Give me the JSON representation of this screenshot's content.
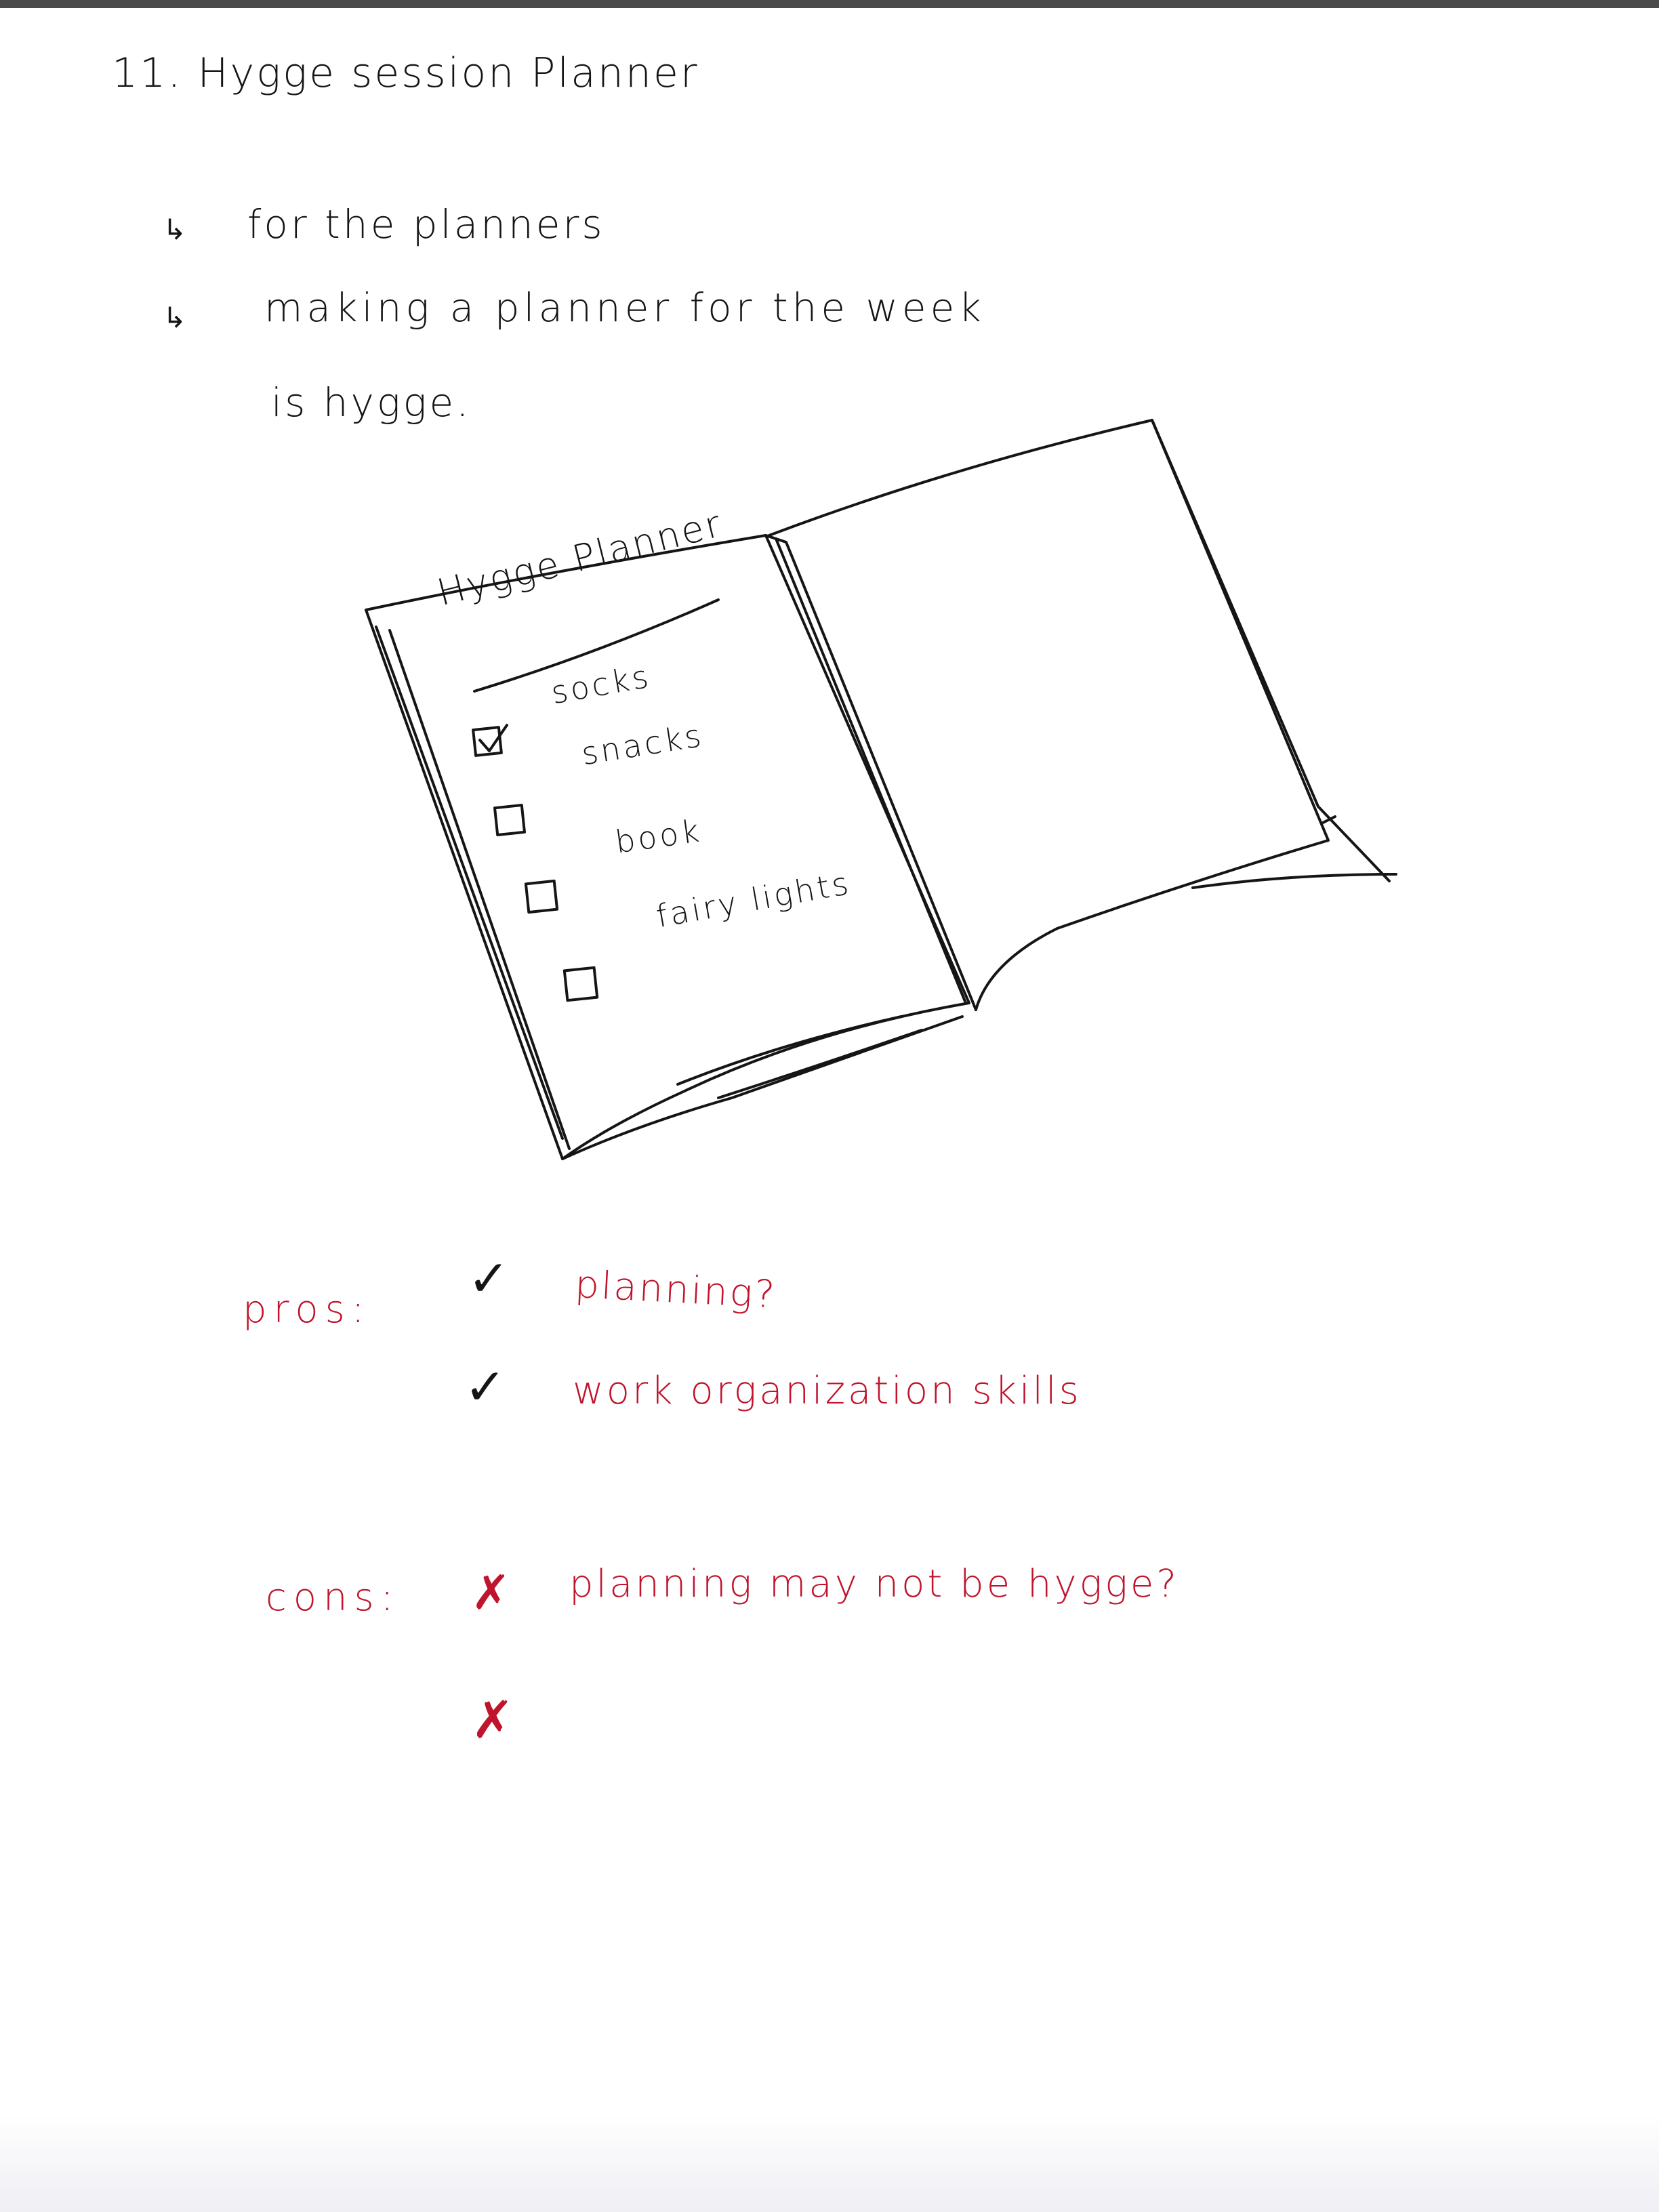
{
  "title": "11. Hygge session Planner",
  "notes": {
    "arrow": "↳",
    "line1": "for the planners",
    "line2a": "making a planner for the week",
    "line2b": "is hygge."
  },
  "sketch": {
    "planner_title": "Hygge Planner",
    "items": [
      {
        "label": "socks",
        "checked": true
      },
      {
        "label": "snacks",
        "checked": false
      },
      {
        "label": "book",
        "checked": false
      },
      {
        "label": "fairy lights",
        "checked": false
      }
    ]
  },
  "pros": {
    "label": "pros:",
    "mark": "✓",
    "items": [
      "planning?",
      "work organization skills"
    ]
  },
  "cons": {
    "label": "cons:",
    "mark": "✗",
    "items": [
      "planning may not be hygge?"
    ],
    "empty_mark": "✗"
  },
  "colors": {
    "ink": "#151515",
    "red_ink": "#c0142c",
    "paper": "#ffffff"
  }
}
